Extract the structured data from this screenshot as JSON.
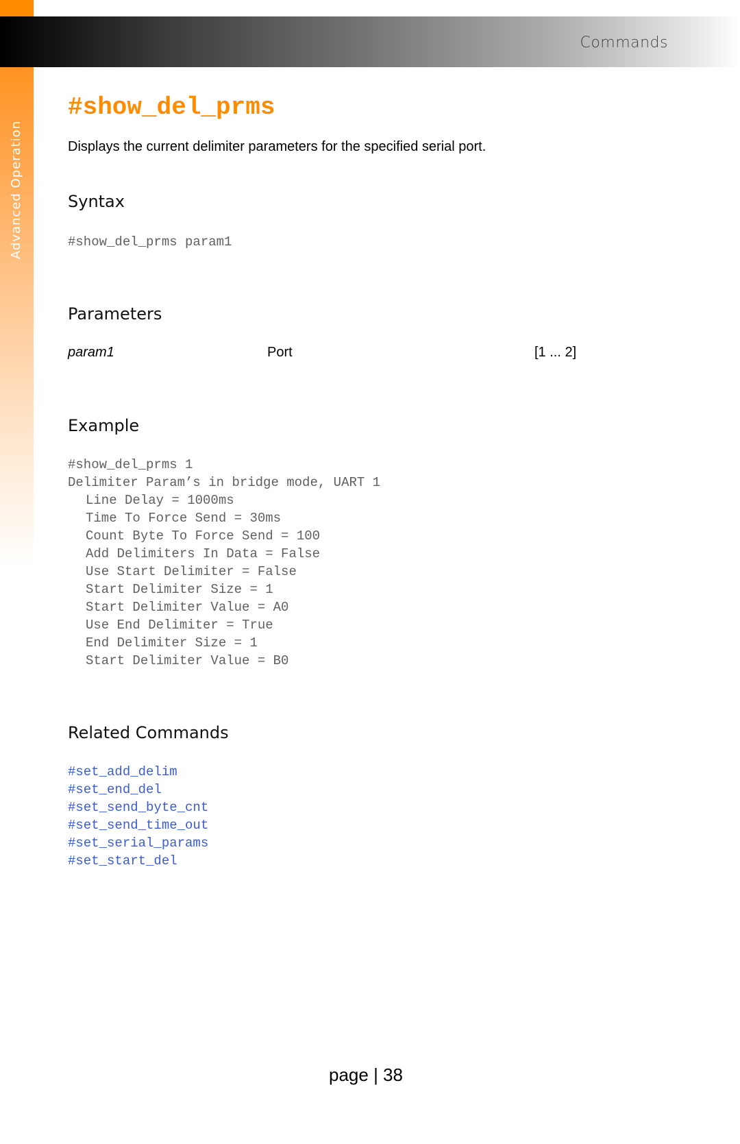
{
  "header": {
    "section_title": "Commands"
  },
  "sidebar": {
    "chapter_label": "Advanced Operation"
  },
  "command": {
    "name": "#show_del_prms",
    "description": "Displays the current delimiter parameters for the specified serial port."
  },
  "syntax": {
    "heading": "Syntax",
    "code": "#show_del_prms param1"
  },
  "parameters": {
    "heading": "Parameters",
    "rows": [
      {
        "name": "param1",
        "description": "Port",
        "range": "[1 ... 2]"
      }
    ]
  },
  "example": {
    "heading": "Example",
    "lines": [
      {
        "text": "#show_del_prms 1",
        "indent": false
      },
      {
        "text": "Delimiter Param’s in bridge mode, UART 1",
        "indent": false
      },
      {
        "text": "Line Delay = 1000ms",
        "indent": true
      },
      {
        "text": "Time To Force Send = 30ms",
        "indent": true
      },
      {
        "text": "Count Byte To Force Send = 100",
        "indent": true
      },
      {
        "text": "Add Delimiters In Data = False",
        "indent": true
      },
      {
        "text": "Use Start Delimiter = False",
        "indent": true
      },
      {
        "text": "Start Delimiter Size = 1",
        "indent": true
      },
      {
        "text": "Start Delimiter Value = A0",
        "indent": true
      },
      {
        "text": "Use End Delimiter = True",
        "indent": true
      },
      {
        "text": "End Delimiter Size = 1",
        "indent": true
      },
      {
        "text": "Start Delimiter Value = B0",
        "indent": true
      }
    ]
  },
  "related": {
    "heading": "Related Commands",
    "commands": [
      "#set_add_delim",
      "#set_end_del",
      "#set_send_byte_cnt",
      "#set_send_time_out",
      "#set_serial_params",
      "#set_start_del"
    ]
  },
  "footer": {
    "page_label": "page | 38"
  },
  "colors": {
    "accent_orange": "#ff8c00",
    "link_blue": "#3b5bdb",
    "code_gray": "#606060"
  }
}
